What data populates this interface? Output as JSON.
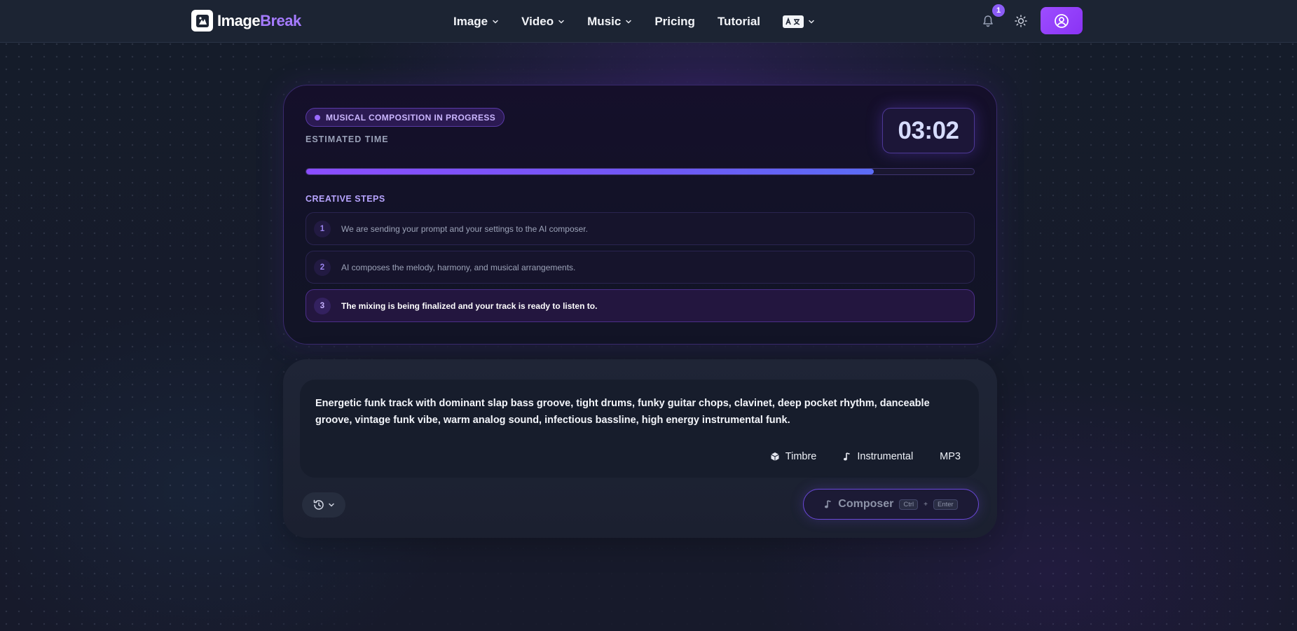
{
  "brand": {
    "name_part1": "Image",
    "name_part2": "Break",
    "accent": "#a57bff"
  },
  "nav": {
    "items": [
      {
        "label": "Image",
        "has_dropdown": true
      },
      {
        "label": "Video",
        "has_dropdown": true
      },
      {
        "label": "Music",
        "has_dropdown": true
      },
      {
        "label": "Pricing",
        "has_dropdown": false
      },
      {
        "label": "Tutorial",
        "has_dropdown": false
      }
    ],
    "language_icon": "translate-icon",
    "notifications_count": "1",
    "icons": {
      "bell": "bell-icon",
      "theme": "sun-icon",
      "user": "user-circle-icon"
    }
  },
  "progress": {
    "status_label": "MUSICAL COMPOSITION IN PROGRESS",
    "estimated_label": "ESTIMATED TIME",
    "timer": "03:02",
    "percent": 85,
    "steps_title": "CREATIVE STEPS",
    "steps": [
      {
        "num": "1",
        "text": "We are sending your prompt and your settings to the AI composer.",
        "active": false
      },
      {
        "num": "2",
        "text": "AI composes the melody, harmony, and musical arrangements.",
        "active": false
      },
      {
        "num": "3",
        "text": "The mixing is being finalized and your track is ready to listen to.",
        "active": true
      }
    ]
  },
  "prompt": {
    "text": "Energetic funk track with dominant slap bass groove, tight drums, funky guitar chops, clavinet, deep pocket rhythm, danceable groove, vintage funk vibe, warm analog sound, infectious bassline, high energy instrumental funk.",
    "options": {
      "timbre": "Timbre",
      "instrumental": "Instrumental",
      "format": "MP3"
    },
    "composer_label": "Composer",
    "shortcut": {
      "key1": "Ctrl",
      "plus": "+",
      "key2": "Enter"
    }
  },
  "colors": {
    "primary": "#8b5cf6",
    "progress_start": "#8b4dff",
    "progress_end": "#5b6cf6"
  }
}
